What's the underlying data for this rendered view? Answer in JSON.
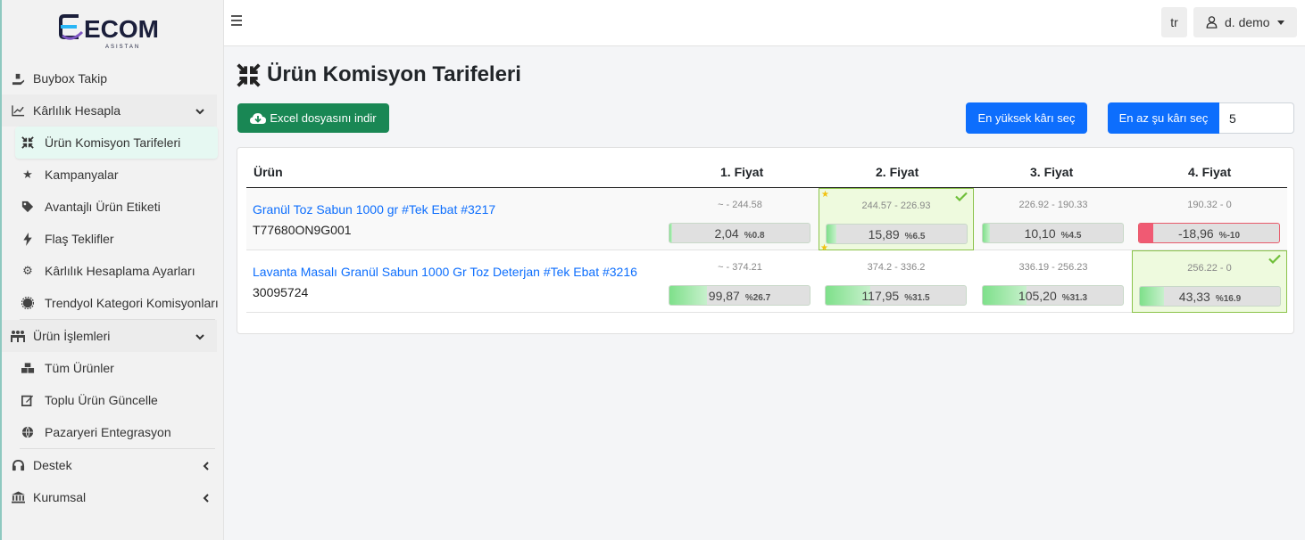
{
  "app": {
    "logo_text": "ECOM",
    "logo_sub": "ASISTAN"
  },
  "sidebar": {
    "items": [
      {
        "label": "Buybox Takip",
        "icon": "buybox-icon"
      },
      {
        "label": "Kârlılık Hesapla",
        "icon": "chart-line-icon",
        "group": true
      },
      {
        "label": "Ürün Komisyon Tarifeleri",
        "icon": "compress-icon",
        "active": true
      },
      {
        "label": "Kampanyalar",
        "icon": "star-icon"
      },
      {
        "label": "Avantajlı Ürün Etiketi",
        "icon": "tag-icon"
      },
      {
        "label": "Flaş Teklifler",
        "icon": "bolt-icon"
      },
      {
        "label": "Kârlılık Hesaplama Ayarları",
        "icon": "gear-icon"
      },
      {
        "label": "Trendyol Kategori Komisyonları",
        "icon": "cog-icon"
      },
      {
        "label": "Ürün İşlemleri",
        "icon": "people-icon",
        "group": true
      },
      {
        "label": "Tüm Ürünler",
        "icon": "boxes-icon"
      },
      {
        "label": "Toplu Ürün Güncelle",
        "icon": "edit-icon"
      },
      {
        "label": "Pazaryeri Entegrasyon",
        "icon": "globe-icon"
      },
      {
        "label": "Destek",
        "icon": "headset-icon"
      },
      {
        "label": "Kurumsal",
        "icon": "bank-icon"
      }
    ]
  },
  "topbar": {
    "lang": "tr",
    "user": "d. demo"
  },
  "page": {
    "title": "Ürün Komisyon Tarifeleri",
    "excel_button": "Excel dosyasını indir",
    "max_profit_button": "En yüksek kârı seç",
    "min_profit_button": "En az şu kârı seç",
    "min_profit_value": "5"
  },
  "table": {
    "headers": [
      "Ürün",
      "1. Fiyat",
      "2. Fiyat",
      "3. Fiyat",
      "4. Fiyat"
    ],
    "rows": [
      {
        "name": "Granül Toz Sabun 1000 gr #Tek Ebat #3217",
        "code": "T77680ON9G001",
        "prices": [
          {
            "range": "~ - 244.58",
            "value": "2,04",
            "pct": "%0.8",
            "fill": 0.02
          },
          {
            "range": "244.57 - 226.93",
            "value": "15,89",
            "pct": "%6.5",
            "fill": 0.07,
            "star": true,
            "selected": true
          },
          {
            "range": "226.92 - 190.33",
            "value": "10,10",
            "pct": "%4.5",
            "fill": 0.05
          },
          {
            "range": "190.32 - 0",
            "value": "-18,96",
            "pct": "%-10",
            "fill": 0.1,
            "negative": true
          }
        ]
      },
      {
        "name": "Lavanta Masalı Granül Sabun 1000 Gr Toz Deterjan #Tek Ebat #3216",
        "code": "30095724",
        "prices": [
          {
            "range": "~ - 374.21",
            "value": "99,87",
            "pct": "%26.7",
            "fill": 0.27
          },
          {
            "range": "374.2 - 336.2",
            "value": "117,95",
            "pct": "%31.5",
            "fill": 0.32,
            "star": true
          },
          {
            "range": "336.19 - 256.23",
            "value": "105,20",
            "pct": "%31.3",
            "fill": 0.31
          },
          {
            "range": "256.22 - 0",
            "value": "43,33",
            "pct": "%16.9",
            "fill": 0.17,
            "selected": true
          }
        ]
      }
    ]
  },
  "colors": {
    "primary": "#0d6efd",
    "success": "#198754",
    "selected_border": "#8bc34a",
    "negative": "#f05a73"
  }
}
